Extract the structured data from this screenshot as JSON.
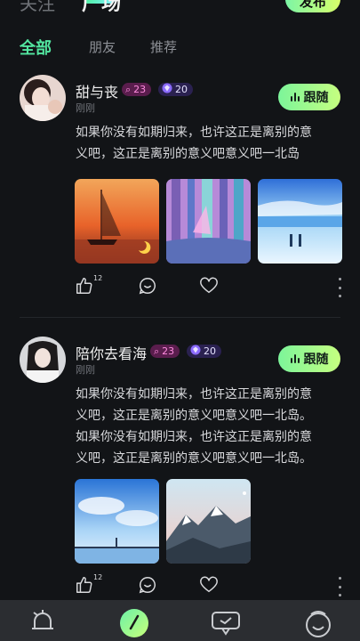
{
  "header": {
    "tabs": [
      {
        "label": "关注"
      },
      {
        "label": "广场"
      }
    ],
    "publish_label": "发布"
  },
  "sub_tabs": [
    {
      "label": "全部",
      "active": true
    },
    {
      "label": "朋友",
      "active": false
    },
    {
      "label": "推荐",
      "active": false
    }
  ],
  "posts": [
    {
      "username": "甜与丧",
      "level": "23",
      "vip": "20",
      "time": "刚刚",
      "follow_label": "跟随",
      "text_lines": [
        "如果你没有如期归来，也许这正是离别的意",
        "义吧，这正是离别的意义吧意义吧一北岛"
      ],
      "images": [
        "sailboat-sunset-image",
        "purple-forest-image",
        "snowy-beach-image"
      ],
      "like_count": "12"
    },
    {
      "username": "陪你去看海",
      "level": "23",
      "vip": "20",
      "time": "刚刚",
      "follow_label": "跟随",
      "text_lines": [
        "如果你没有如期归来，也许这正是离别的意",
        "义吧，这正是离别的意义吧意义吧一北岛。",
        "如果你没有如期归来，也许这正是离别的意",
        "义吧，这正是离别的意义吧意义吧一北岛。"
      ],
      "images": [
        "blue-sky-pier-image",
        "snow-mountain-image"
      ],
      "like_count": "12"
    }
  ],
  "bottom_nav": [
    {
      "icon": "bell-icon"
    },
    {
      "icon": "plaza-icon",
      "active": true
    },
    {
      "icon": "message-icon"
    },
    {
      "icon": "profile-face-icon"
    }
  ],
  "colors": {
    "accent": "#53e6a0",
    "background": "#121417",
    "level_badge": "#ff8de0",
    "vip_badge": "#2a2150"
  }
}
